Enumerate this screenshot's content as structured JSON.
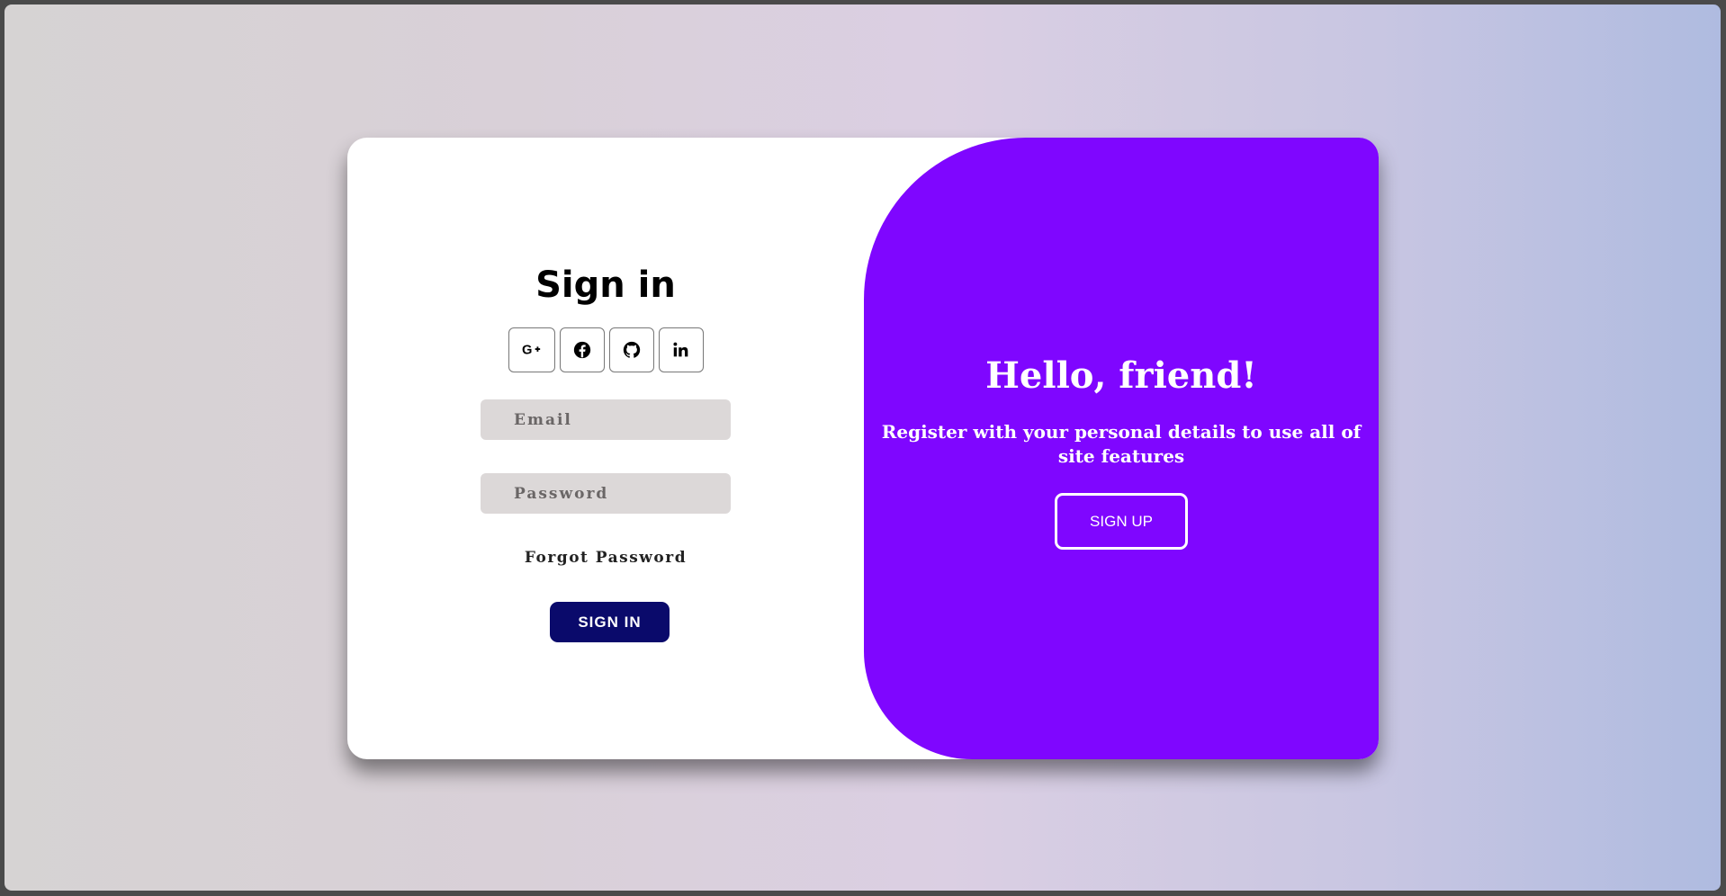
{
  "signin": {
    "title": "Sign in",
    "socials": [
      {
        "icon": "google-plus-icon"
      },
      {
        "icon": "facebook-icon"
      },
      {
        "icon": "github-icon"
      },
      {
        "icon": "linkedin-icon"
      }
    ],
    "email_placeholder": "Email",
    "password_placeholder": "Password",
    "forgot_label": "Forgot Password",
    "button_label": "SIGN IN"
  },
  "welcome": {
    "heading": "Hello, friend!",
    "text": "Register with your personal details to use all of site features",
    "button_label": "SIGN UP"
  },
  "colors": {
    "accent": "#7f06ff",
    "signin_button": "#0a0a6b",
    "input_bg": "#dcd8d8"
  }
}
